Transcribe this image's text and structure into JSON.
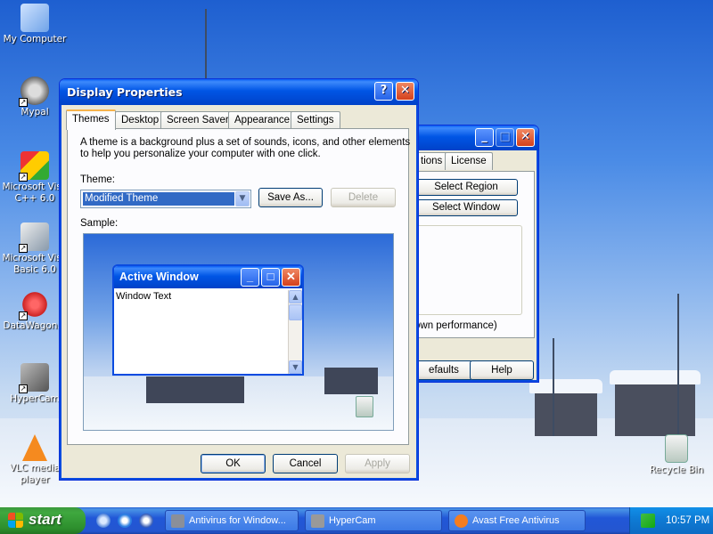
{
  "desktop": {
    "icons": [
      {
        "label": "My Computer",
        "icon": "my-computer-icon"
      },
      {
        "label": "Mypal",
        "icon": "mypal-icon"
      },
      {
        "label": "Microsoft Visual C++ 6.0",
        "label_line1": "Microsoft Visu",
        "label_line2": "C++ 6.0",
        "icon": "visual-cpp-icon"
      },
      {
        "label_line1": "Microsoft Visu",
        "label_line2": "Basic 6.0",
        "icon": "visual-basic-icon"
      },
      {
        "label": "DataWagon...",
        "icon": "datawagon-icon"
      },
      {
        "label": "HyperCam 2",
        "label_shown": "HyperCam",
        "icon": "hypercam-icon"
      },
      {
        "label_line1": "VLC media",
        "label_line2": "player",
        "icon": "vlc-icon"
      },
      {
        "label": "Recycle Bin",
        "icon": "recycle-bin-icon"
      }
    ]
  },
  "bg_window": {
    "tabs": [
      "tions",
      "License"
    ],
    "buttons": {
      "select_region": "Select Region",
      "select_window": "Select Window",
      "defaults": "efaults",
      "help": "Help"
    },
    "text": "own performance)"
  },
  "dialog": {
    "title": "Display Properties",
    "help_glyph": "?",
    "close_glyph": "✕",
    "tabs": [
      "Themes",
      "Desktop",
      "Screen Saver",
      "Appearance",
      "Settings"
    ],
    "description_line1": "A theme is a background plus a set of sounds, icons, and other elements",
    "description_line2": "to help you personalize your computer with one click.",
    "theme_label": "Theme:",
    "theme_value": "Modified Theme",
    "save_as": "Save As...",
    "delete": "Delete",
    "sample_label": "Sample:",
    "sample_window_title": "Active Window",
    "sample_window_text": "Window Text",
    "ok": "OK",
    "cancel": "Cancel",
    "apply": "Apply"
  },
  "taskbar": {
    "start": "start",
    "items": [
      {
        "label": "Antivirus for Window...",
        "icon": "antivirus-icon"
      },
      {
        "label": "HyperCam",
        "icon": "hypercam-icon"
      },
      {
        "label": "Avast Free Antivirus",
        "icon": "avast-icon"
      }
    ],
    "clock": "10:57 PM"
  },
  "colors": {
    "accent": "#0055e5",
    "start_green": "#3fa83f",
    "selection": "#316ac5"
  }
}
